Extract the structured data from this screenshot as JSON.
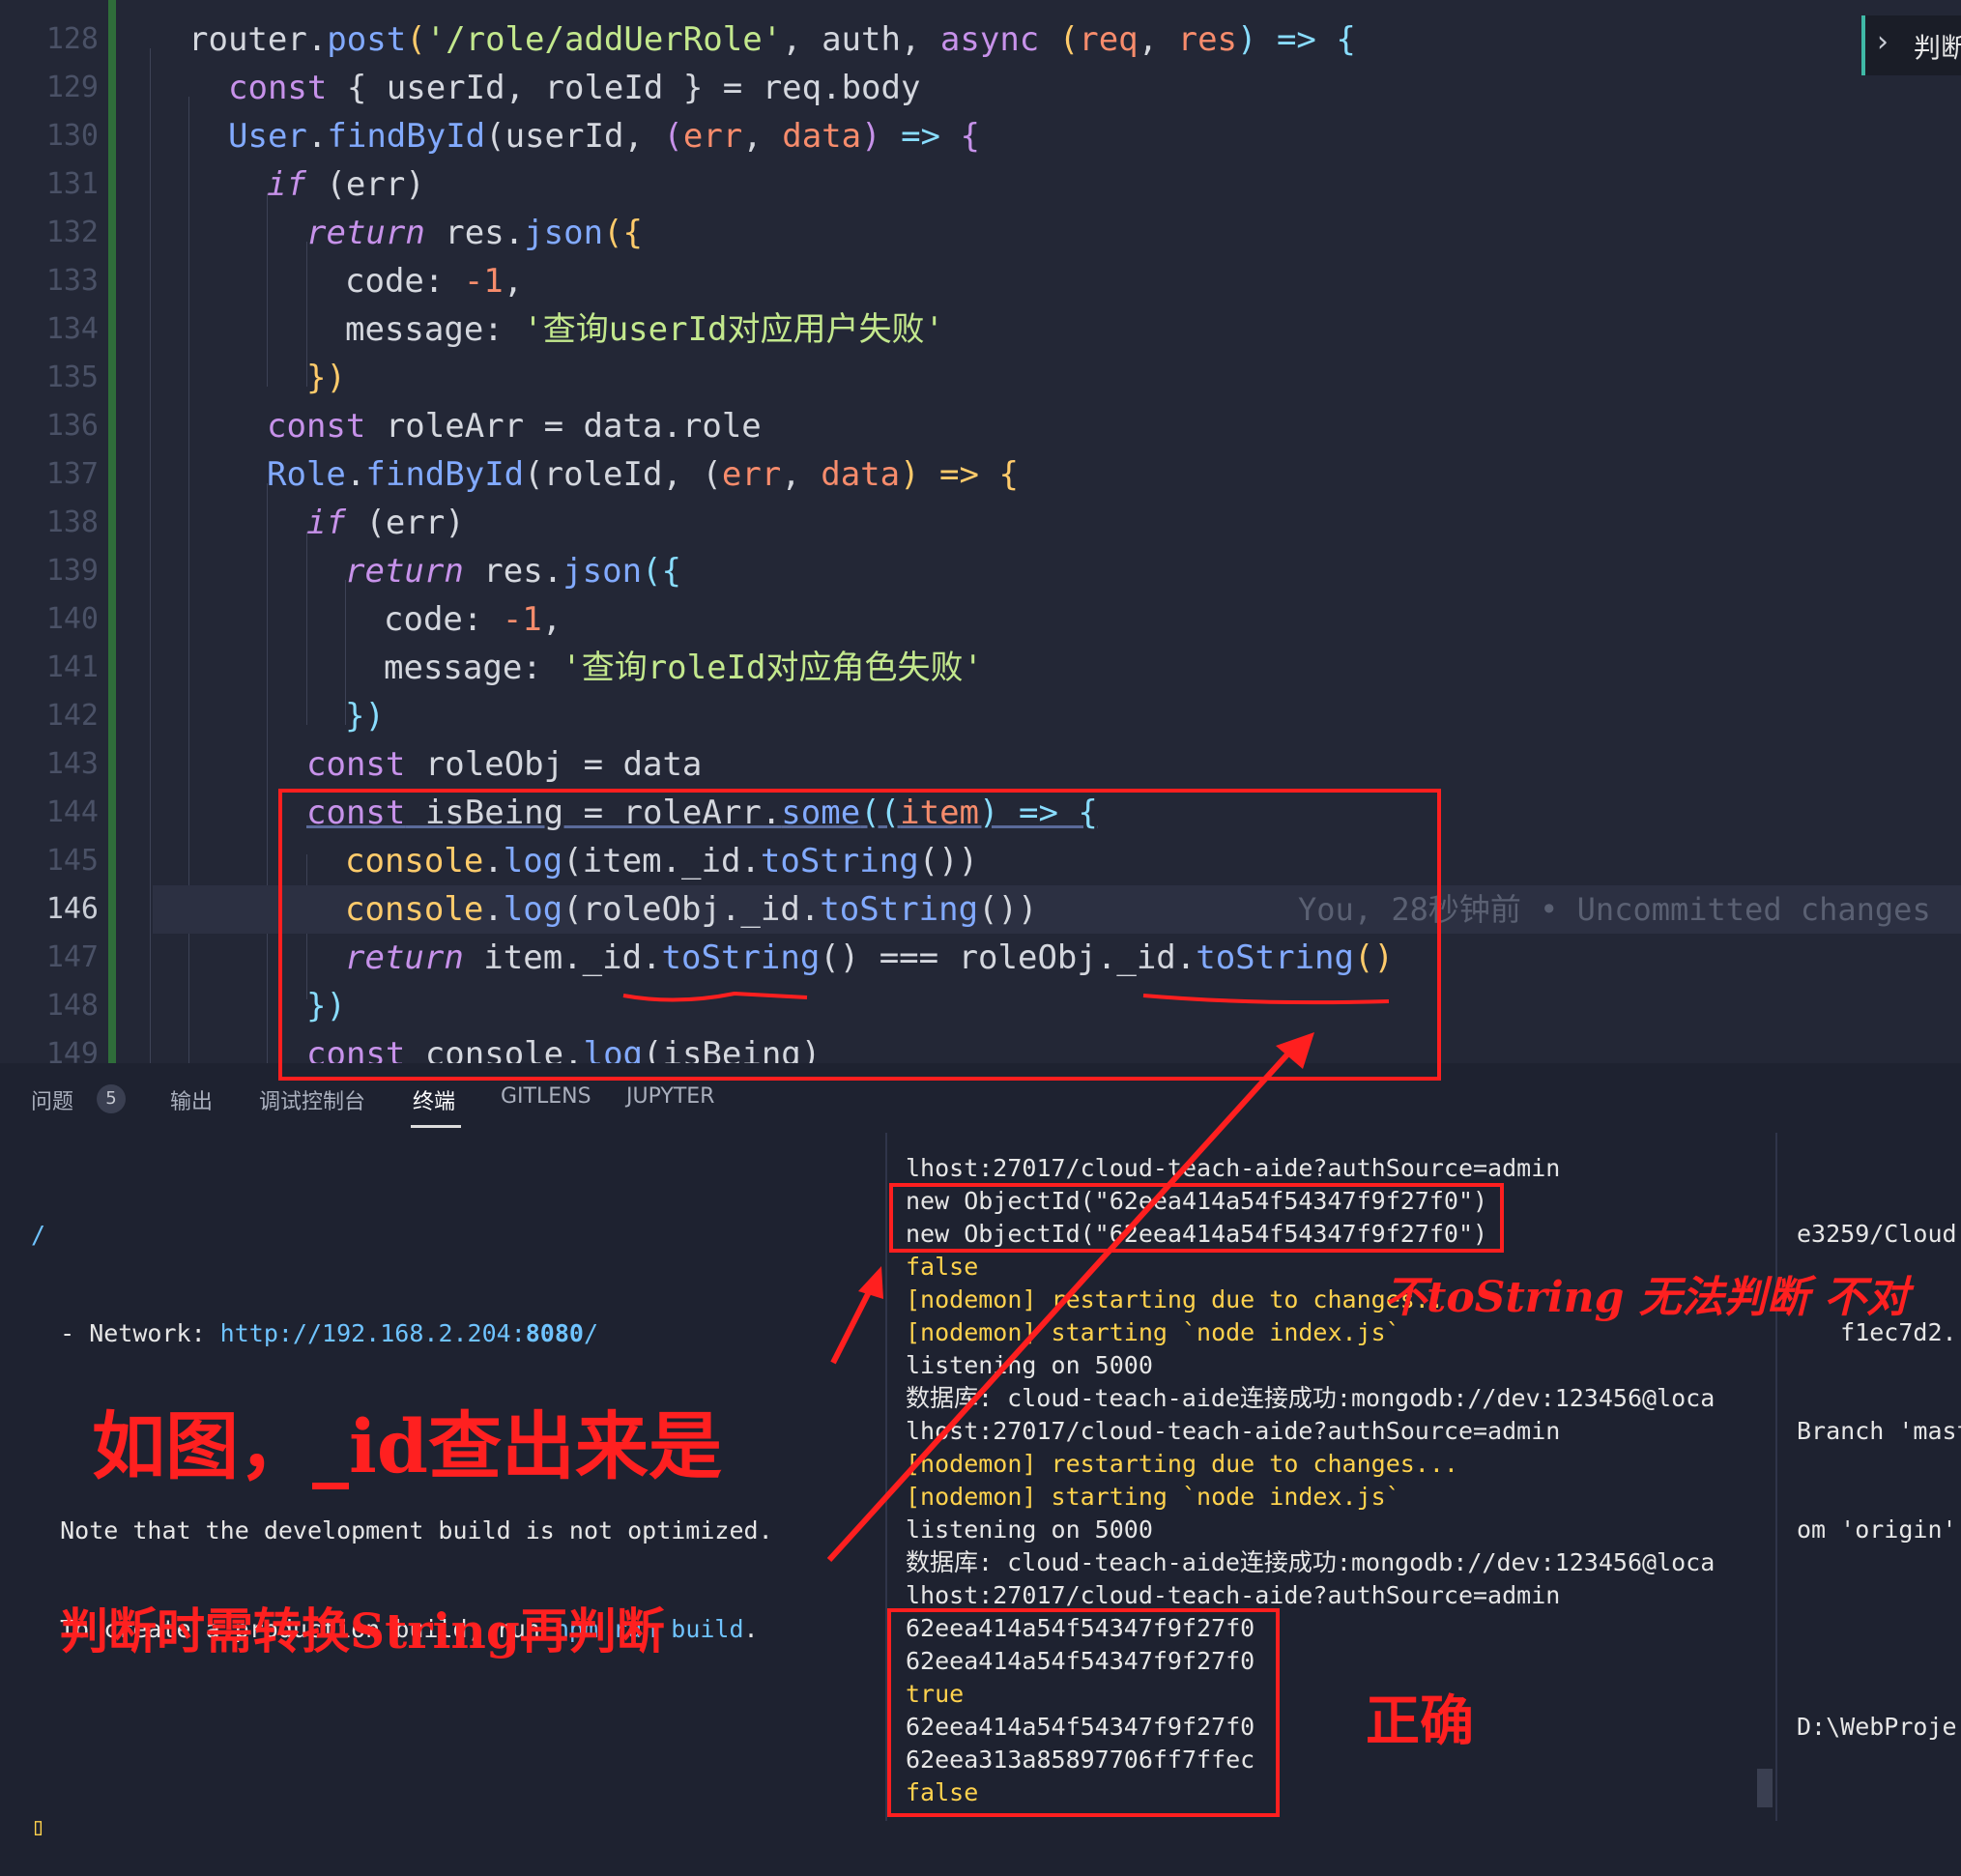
{
  "editor": {
    "outline_button_label": "判断",
    "blame": "You, 28秒钟前 • Uncommitted changes",
    "lines": [
      {
        "n": "128"
      },
      {
        "n": "129"
      },
      {
        "n": "130"
      },
      {
        "n": "131"
      },
      {
        "n": "132"
      },
      {
        "n": "133"
      },
      {
        "n": "134"
      },
      {
        "n": "135"
      },
      {
        "n": "136"
      },
      {
        "n": "137"
      },
      {
        "n": "138"
      },
      {
        "n": "139"
      },
      {
        "n": "140"
      },
      {
        "n": "141"
      },
      {
        "n": "142"
      },
      {
        "n": "143"
      },
      {
        "n": "144"
      },
      {
        "n": "145"
      },
      {
        "n": "146"
      },
      {
        "n": "147"
      },
      {
        "n": "148"
      },
      {
        "n": "149"
      }
    ],
    "code": {
      "l128": {
        "a": "router.",
        "b": "post",
        "c": "(",
        "d": "'/role/addUerRole'",
        "e": ", auth, ",
        "f": "async",
        "g": " (",
        "h": "req",
        "i": ", ",
        "j": "res",
        "k": ") => {"
      },
      "l129": {
        "a": "const",
        "b": " { userId, roleId } = req.body"
      },
      "l130": {
        "a": "User.",
        "b": "findById",
        "c": "(userId, (",
        "d": "err",
        ",e": ", ",
        "f": "data",
        "g": ") => {"
      },
      "l131": {
        "a": "if",
        "b": " (err)"
      },
      "l132": {
        "a": "return",
        "b": " res.",
        "c": "json",
        "d": "({"
      },
      "l133": {
        "a": "code: ",
        "b": "-1",
        ",c": ","
      },
      "l134": {
        "a": "message: ",
        "b": "'查询userId对应用户失败'"
      },
      "l135": {
        "a": "})"
      },
      "l136": {
        "a": "const",
        "b": " roleArr = data.role"
      },
      "l137": {
        "a": "Role.",
        "b": "findById",
        "c": "(roleId, (",
        "d": "err",
        "e": ", ",
        "f": "data",
        "g": ") => {"
      },
      "l138": {
        "a": "if",
        "b": " (err)"
      },
      "l139": {
        "a": "return",
        "b": " res.",
        "c": "json",
        "d": "({"
      },
      "l140": {
        "a": "code: ",
        "b": "-1",
        "c": ","
      },
      "l141": {
        "a": "message: ",
        "b": "'查询roleId对应角色失败'"
      },
      "l142": {
        "a": "})"
      },
      "l143": {
        "a": "const",
        "b": " roleObj = data"
      },
      "l144": {
        "a": "const",
        "b": " isBeing = roleArr.",
        "c": "some",
        "d": "((",
        "e": "item",
        "f": ") => {"
      },
      "l145": {
        "a": "console",
        "b": ".",
        "c": "log",
        "d": "(item._id.",
        "e": "toString",
        "f": "())"
      },
      "l146": {
        "a": "console",
        "b": ".",
        "c": "log",
        "d": "(roleObj._id.",
        "e": "toString",
        "f": "())"
      },
      "l147": {
        "a": "return",
        "b": " item._id.",
        "c": "toString",
        "d": "() === roleObj._id.",
        "e": "toString",
        "f": "()"
      },
      "l148": {
        "a": "})"
      },
      "l149": {
        "a": "console.",
        "b": "log",
        "c": "(isBeing)"
      }
    }
  },
  "panel": {
    "tabs": [
      "问题",
      "输出",
      "调试控制台",
      "终端",
      "GITLENS",
      "JUPYTER"
    ],
    "problems_count": "5",
    "active_tab": "终端"
  },
  "terminal_left": {
    "l1": "/",
    "l2_prefix": "  - Network: ",
    "l2_url_a": "http://192.168.2.204:",
    "l2_url_b": "8080",
    "l2_url_c": "/",
    "l3": "  Note that the development build is not optimized.",
    "l4_a": "  To create a production build, run ",
    "l4_b": "npm run build",
    "l4_c": ".",
    "cursor": "▯"
  },
  "terminal_middle": [
    {
      "t": "lhost:27017/cloud-teach-aide?authSource=admin",
      "c": "w"
    },
    {
      "t": "new ObjectId(\"62eea414a54f54347f9f27f0\")",
      "c": "w"
    },
    {
      "t": "new ObjectId(\"62eea414a54f54347f9f27f0\")",
      "c": "w"
    },
    {
      "t": "false",
      "c": "yl"
    },
    {
      "t": "[nodemon] restarting due to changes...",
      "c": "yl"
    },
    {
      "t": "[nodemon] starting `node index.js`",
      "c": "yl"
    },
    {
      "t": "listening on 5000",
      "c": "w"
    },
    {
      "t": "数据库: cloud-teach-aide连接成功:mongodb://dev:123456@loca",
      "c": "w"
    },
    {
      "t": "lhost:27017/cloud-teach-aide?authSource=admin",
      "c": "w"
    },
    {
      "t": "[nodemon] restarting due to changes...",
      "c": "yl"
    },
    {
      "t": "[nodemon] starting `node index.js`",
      "c": "yl"
    },
    {
      "t": "listening on 5000",
      "c": "w"
    },
    {
      "t": "数据库: cloud-teach-aide连接成功:mongodb://dev:123456@loca",
      "c": "w"
    },
    {
      "t": "lhost:27017/cloud-teach-aide?authSource=admin",
      "c": "w"
    },
    {
      "t": "62eea414a54f54347f9f27f0",
      "c": "w"
    },
    {
      "t": "62eea414a54f54347f9f27f0",
      "c": "w"
    },
    {
      "t": "true",
      "c": "yl"
    },
    {
      "t": "62eea414a54f54347f9f27f0",
      "c": "w"
    },
    {
      "t": "62eea313a85897706ff7ffec",
      "c": "w"
    },
    {
      "t": "false",
      "c": "yl"
    }
  ],
  "terminal_right": {
    "l1": "e3259/Cloud",
    "l2": "   f1ec7d2.",
    "l3": "Branch 'mast",
    "l4": "om 'origin'",
    "l5": "D:\\WebProje"
  },
  "annotations": {
    "note_left_1": "如图，_id查出来是",
    "note_left_2": "判断时需转换String再判断",
    "note_right": "不toString 无法判断 不对",
    "note_correct": "正确",
    "color": "#ff1f1f"
  }
}
